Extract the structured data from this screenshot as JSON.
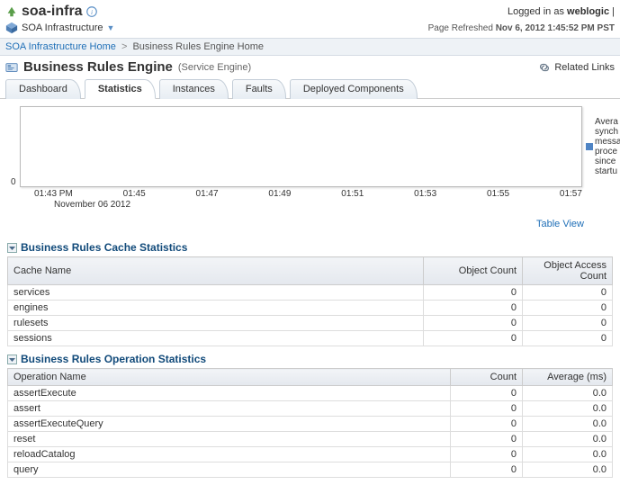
{
  "header": {
    "title": "soa-infra",
    "menu_label": "SOA Infrastructure",
    "logged_in_prefix": "Logged in as",
    "logged_in_user": "weblogic",
    "refresh_prefix": "Page Refreshed",
    "refresh_time": "Nov 6, 2012 1:45:52 PM PST"
  },
  "breadcrumb": {
    "home": "SOA Infrastructure Home",
    "sep": ">",
    "current": "Business Rules Engine Home"
  },
  "page": {
    "title": "Business Rules Engine",
    "subtitle": "(Service Engine)",
    "related_links": "Related Links"
  },
  "tabs": {
    "dashboard": "Dashboard",
    "statistics": "Statistics",
    "instances": "Instances",
    "faults": "Faults",
    "deployed": "Deployed Components"
  },
  "chart_data": {
    "type": "line",
    "title": "",
    "xlabel": "November 06 2012",
    "ylabel": "",
    "ylim": [
      0,
      0
    ],
    "x_ticks": [
      "01:43 PM",
      "01:45",
      "01:47",
      "01:49",
      "01:51",
      "01:53",
      "01:55",
      "01:57"
    ],
    "y_ticks": [
      "0"
    ],
    "series": [
      {
        "name": "Average synchronous message processing since startup",
        "values": []
      }
    ],
    "legend_visible_text": "Avera\nsynch\nmessa\nproce\nsince\nstartu",
    "table_view_label": "Table View"
  },
  "cache_section": {
    "title": "Business Rules Cache Statistics",
    "headers": {
      "name": "Cache Name",
      "count": "Object Count",
      "access": "Object Access Count"
    },
    "rows": [
      {
        "name": "services",
        "count": "0",
        "access": "0"
      },
      {
        "name": "engines",
        "count": "0",
        "access": "0"
      },
      {
        "name": "rulesets",
        "count": "0",
        "access": "0"
      },
      {
        "name": "sessions",
        "count": "0",
        "access": "0"
      }
    ]
  },
  "op_section": {
    "title": "Business Rules Operation Statistics",
    "headers": {
      "name": "Operation Name",
      "count": "Count",
      "avg": "Average (ms)"
    },
    "rows": [
      {
        "name": "assertExecute",
        "count": "0",
        "avg": "0.0"
      },
      {
        "name": "assert",
        "count": "0",
        "avg": "0.0"
      },
      {
        "name": "assertExecuteQuery",
        "count": "0",
        "avg": "0.0"
      },
      {
        "name": "reset",
        "count": "0",
        "avg": "0.0"
      },
      {
        "name": "reloadCatalog",
        "count": "0",
        "avg": "0.0"
      },
      {
        "name": "query",
        "count": "0",
        "avg": "0.0"
      }
    ]
  }
}
